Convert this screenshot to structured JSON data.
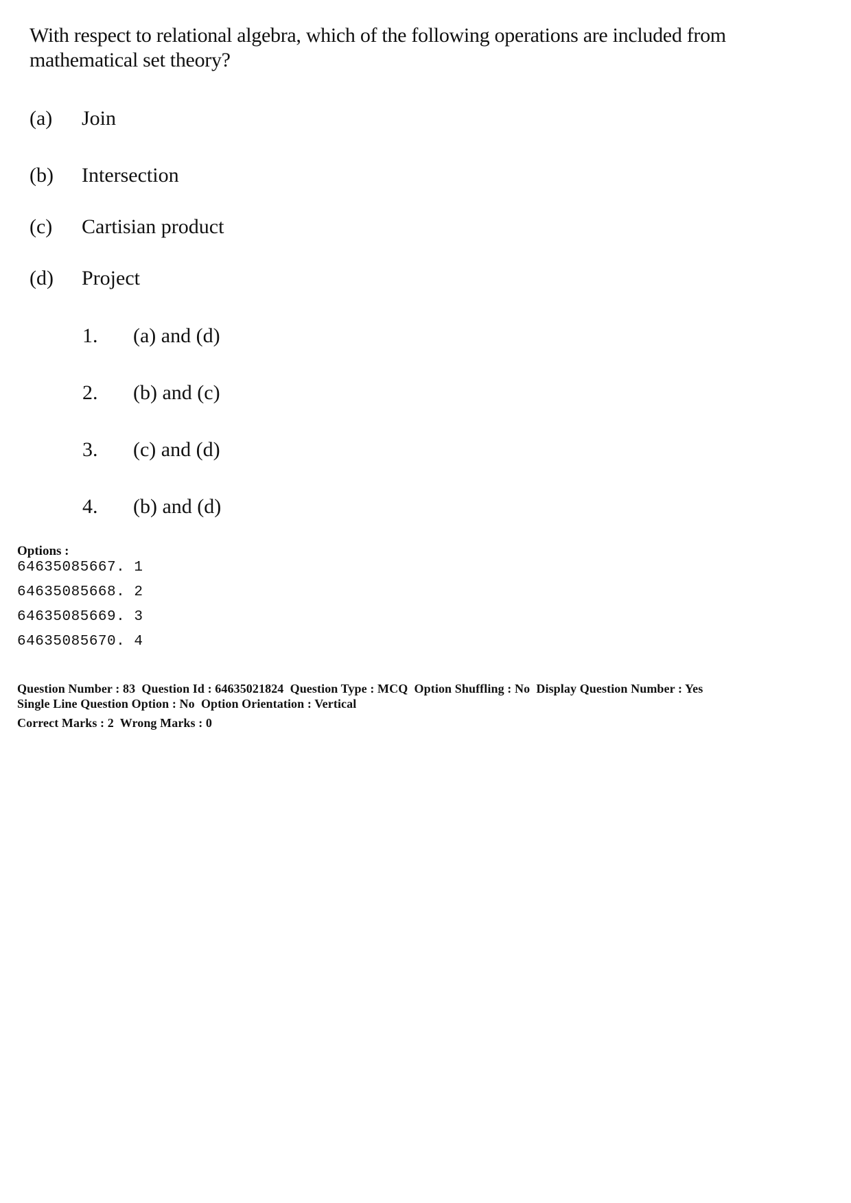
{
  "question": {
    "text": "With respect to relational algebra, which of the following operations are included from mathematical set theory?",
    "items": [
      {
        "label": "(a)",
        "text": "Join"
      },
      {
        "label": "(b)",
        "text": "Intersection"
      },
      {
        "label": "(c)",
        "text": "Cartisian product"
      },
      {
        "label": "(d)",
        "text": "Project"
      }
    ],
    "choices": [
      {
        "label": "1.",
        "text": "(a) and (d)"
      },
      {
        "label": "2.",
        "text": "(b) and (c)"
      },
      {
        "label": "3.",
        "text": "(c) and (d)"
      },
      {
        "label": "4.",
        "text": "(b) and (d)"
      }
    ]
  },
  "options": {
    "heading": "Options :",
    "rows": [
      "64635085667. 1",
      "64635085668. 2",
      "64635085669. 3",
      "64635085670. 4"
    ]
  },
  "meta": {
    "line1": "Question Number : 83  Question Id : 64635021824  Question Type : MCQ  Option Shuffling : No  Display Question Number : Yes",
    "line2": "Single Line Question Option : No  Option Orientation : Vertical",
    "line3": "Correct Marks : 2  Wrong Marks : 0"
  }
}
